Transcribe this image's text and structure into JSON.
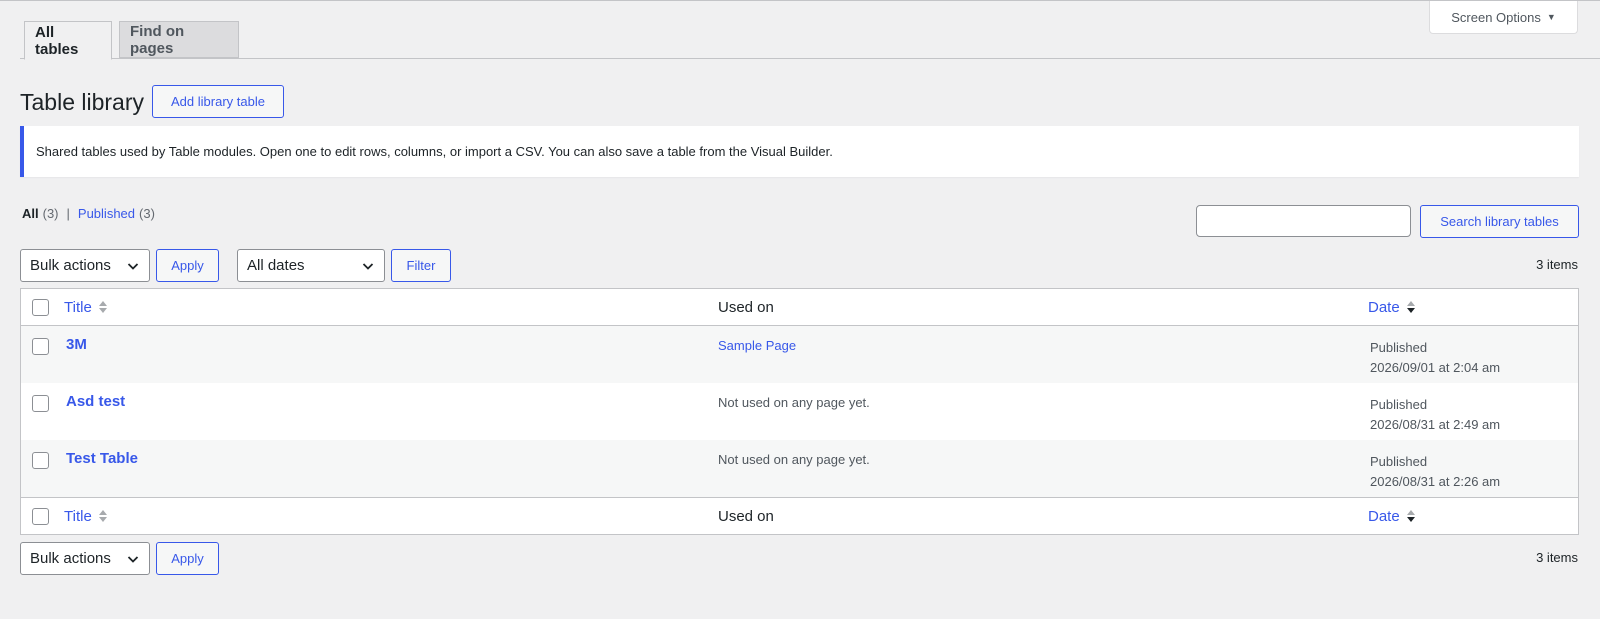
{
  "screen_options": {
    "label": "Screen Options"
  },
  "tabs": [
    {
      "label": "All tables",
      "active": true
    },
    {
      "label": "Find on pages",
      "active": false
    }
  ],
  "page_title": "Table library",
  "add_button": "Add library table",
  "notice": "Shared tables used by Table modules. Open one to edit rows, columns, or import a CSV. You can also save a table from the Visual Builder.",
  "views": {
    "all_label": "All",
    "all_count": "(3)",
    "separator": "|",
    "published_label": "Published",
    "published_count": "(3)"
  },
  "search": {
    "value": "",
    "button": "Search library tables"
  },
  "top_nav": {
    "bulk_actions": "Bulk actions",
    "apply": "Apply",
    "dates": "All dates",
    "filter": "Filter",
    "count": "3 items"
  },
  "bottom_nav": {
    "bulk_actions": "Bulk actions",
    "apply": "Apply",
    "count": "3 items"
  },
  "columns": {
    "title": "Title",
    "used_on": "Used on",
    "date": "Date"
  },
  "rows": [
    {
      "title": "3M",
      "used_on": "Sample Page",
      "status": "Published",
      "date": "2026/09/01 at 2:04 am"
    },
    {
      "title": "Asd test",
      "used_on": "Not used on any page yet.",
      "status": "Published",
      "date": "2026/08/31 at 2:49 am"
    },
    {
      "title": "Test Table",
      "used_on": "Not used on any page yet.",
      "status": "Published",
      "date": "2026/08/31 at 2:26 am"
    }
  ],
  "colors": {
    "accent": "#3858e9",
    "background": "#f0f0f1",
    "border": "#c3c4c7"
  }
}
